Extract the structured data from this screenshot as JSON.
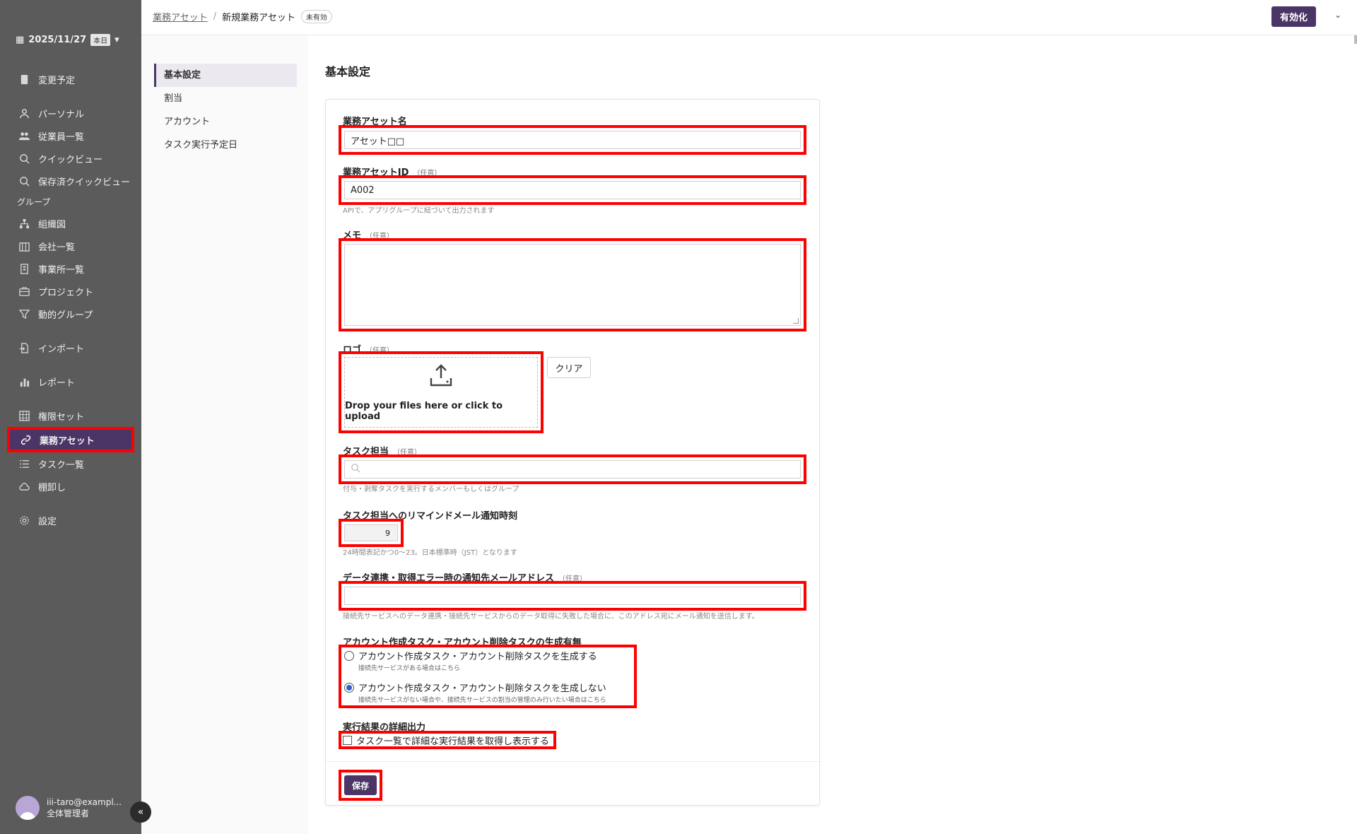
{
  "sidebar": {
    "date": "2025/11/27",
    "today_label": "本日",
    "items": {
      "schedule": "変更予定",
      "personal": "パーソナル",
      "employees": "従業員一覧",
      "quickview": "クイックビュー",
      "saved_quickview": "保存済クイックビュー",
      "group_label": "グループ",
      "org_chart": "組織図",
      "companies": "会社一覧",
      "offices": "事業所一覧",
      "projects": "プロジェクト",
      "dynamic_groups": "動的グループ",
      "import": "インポート",
      "report": "レポート",
      "permission_sets": "権限セット",
      "business_assets": "業務アセット",
      "tasks": "タスク一覧",
      "inventory": "棚卸し",
      "settings": "設定"
    },
    "user": {
      "email": "iii-taro@exampl...",
      "role": "全体管理者"
    }
  },
  "topbar": {
    "breadcrumb_parent": "業務アセット",
    "breadcrumb_separator": "/",
    "breadcrumb_current": "新規業務アセット",
    "status": "未有効",
    "enable_button": "有効化"
  },
  "subnav": {
    "basic": "基本設定",
    "assignment": "割当",
    "account": "アカウント",
    "task_schedule": "タスク実行予定日"
  },
  "form": {
    "section_title": "基本設定",
    "optional": "（任意）",
    "name_label": "業務アセット名",
    "name_value": "アセット□□",
    "id_label": "業務アセットID",
    "id_value": "A002",
    "id_hint": "APIで、アプリグループに紐づいて出力されます",
    "memo_label": "メモ",
    "memo_value": "",
    "logo_label": "ロゴ",
    "upload_text": "Drop your files here or click to upload",
    "clear_button": "クリア",
    "assignee_label": "タスク担当",
    "assignee_value": "",
    "assignee_hint": "付与・剥奪タスクを実行するメンバーもしくはグループ",
    "remind_label": "タスク担当へのリマインドメール通知時刻",
    "remind_value": "9",
    "remind_hint": "24時間表記かつ0～23。日本標準時（JST）となります",
    "error_email_label": "データ連携・取得エラー時の通知先メールアドレス",
    "error_email_value": "",
    "error_email_hint": "接続先サービスへのデータ連携・接続先サービスからのデータ取得に失敗した場合に、このアドレス宛にメール通知を送信します。",
    "task_gen_label": "アカウント作成タスク・アカウント削除タスクの生成有無",
    "task_gen_option1": "アカウント作成タスク・アカウント削除タスクを生成する",
    "task_gen_option1_sub": "接続先サービスがある場合はこちら",
    "task_gen_option2": "アカウント作成タスク・アカウント削除タスクを生成しない",
    "task_gen_option2_sub": "接続先サービスがない場合や、接続先サービスの割当の管理のみ行いたい場合はこちら",
    "task_gen_selected": 2,
    "detail_label": "実行結果の詳細出力",
    "detail_checkbox": "タスク一覧で詳細な実行結果を取得し表示する",
    "detail_checked": false,
    "save_button": "保存"
  },
  "colors": {
    "accent": "#4a3566",
    "sidebar": "#5b5b5b",
    "highlight": "#ff0000"
  }
}
